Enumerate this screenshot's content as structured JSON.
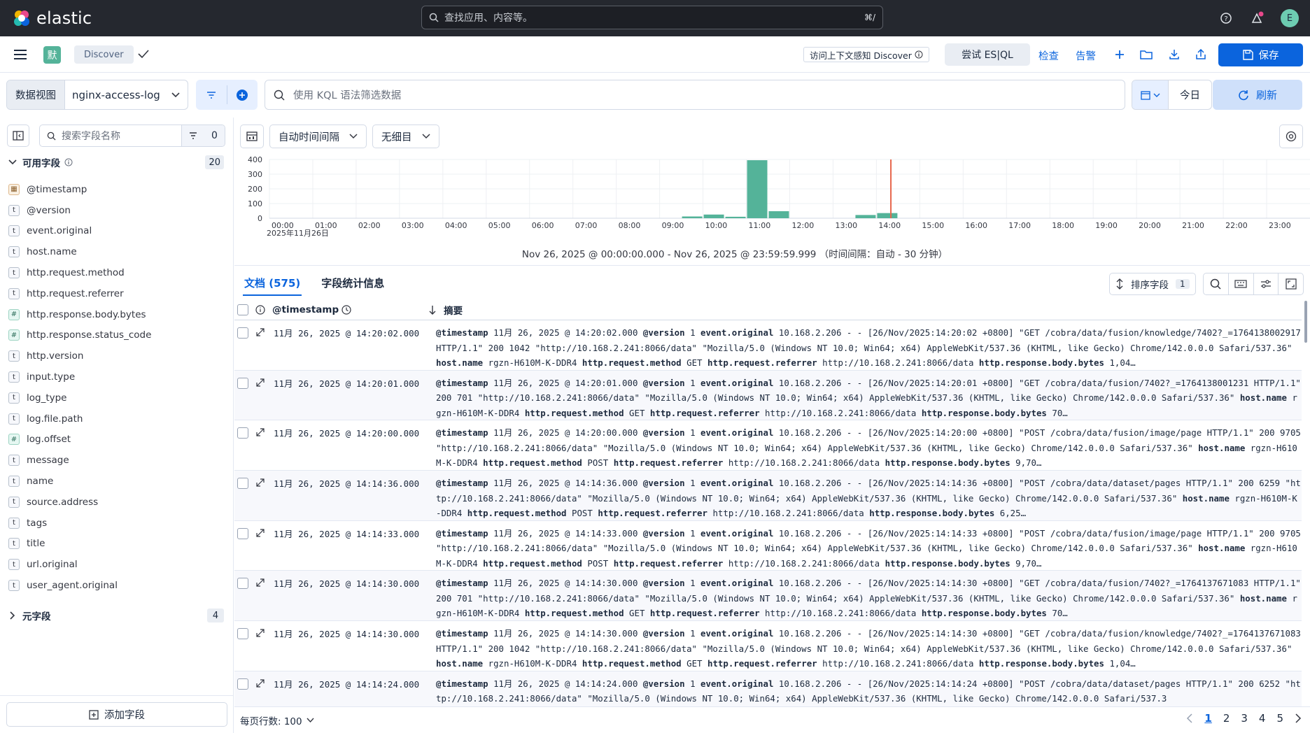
{
  "header": {
    "brand": "elastic",
    "search_placeholder": "查找应用、内容等。",
    "search_shortcut": "⌘/",
    "avatar_initial": "E",
    "colors": {
      "header_bg": "#25282f",
      "accent": "#0b64dd",
      "brand_green": "#54b399"
    }
  },
  "appbar": {
    "space_initial": "默",
    "breadcrumb": "Discover",
    "context_button": "访问上下文感知 Discover",
    "esql_button": "尝试 ES|QL",
    "inspect": "检查",
    "alerts": "告警",
    "save": "保存"
  },
  "querybar": {
    "dataview_label": "数据视图",
    "dataview_value": "nginx-access-log",
    "kql_placeholder": "使用 KQL 语法筛选数据",
    "date_text": "今日",
    "refresh": "刷新"
  },
  "sidebar": {
    "search_placeholder": "搜索字段名称",
    "filter_count": "0",
    "available_title": "可用字段",
    "available_count": "20",
    "meta_title": "元字段",
    "meta_count": "4",
    "add_field": "添加字段",
    "fields": [
      {
        "name": "@timestamp",
        "type": "date",
        "glyph": "▦"
      },
      {
        "name": "@version",
        "type": "text",
        "glyph": "t"
      },
      {
        "name": "event.original",
        "type": "text",
        "glyph": "t"
      },
      {
        "name": "host.name",
        "type": "text",
        "glyph": "t"
      },
      {
        "name": "http.request.method",
        "type": "text",
        "glyph": "t"
      },
      {
        "name": "http.request.referrer",
        "type": "text",
        "glyph": "t"
      },
      {
        "name": "http.response.body.bytes",
        "type": "number",
        "glyph": "#"
      },
      {
        "name": "http.response.status_code",
        "type": "number",
        "glyph": "#"
      },
      {
        "name": "http.version",
        "type": "text",
        "glyph": "t"
      },
      {
        "name": "input.type",
        "type": "text",
        "glyph": "t"
      },
      {
        "name": "log_type",
        "type": "text",
        "glyph": "t"
      },
      {
        "name": "log.file.path",
        "type": "text",
        "glyph": "t"
      },
      {
        "name": "log.offset",
        "type": "number",
        "glyph": "#"
      },
      {
        "name": "message",
        "type": "text",
        "glyph": "t"
      },
      {
        "name": "name",
        "type": "text",
        "glyph": "t"
      },
      {
        "name": "source.address",
        "type": "text",
        "glyph": "t"
      },
      {
        "name": "tags",
        "type": "text",
        "glyph": "t"
      },
      {
        "name": "title",
        "type": "text",
        "glyph": "t"
      },
      {
        "name": "url.original",
        "type": "text",
        "glyph": "t"
      },
      {
        "name": "user_agent.original",
        "type": "text",
        "glyph": "t"
      }
    ]
  },
  "chart_tools": {
    "interval": "自动时间间隔",
    "breakdown": "无细目"
  },
  "chart_data": {
    "type": "bar",
    "categories": [
      "00:00",
      "00:30",
      "01:00",
      "01:30",
      "02:00",
      "02:30",
      "03:00",
      "03:30",
      "04:00",
      "04:30",
      "05:00",
      "05:30",
      "06:00",
      "06:30",
      "07:00",
      "07:30",
      "08:00",
      "08:30",
      "09:00",
      "09:30",
      "10:00",
      "10:30",
      "11:00",
      "11:30",
      "12:00",
      "12:30",
      "13:00",
      "13:30",
      "14:00",
      "14:30",
      "15:00",
      "15:30",
      "16:00",
      "16:30",
      "17:00",
      "17:30",
      "18:00",
      "18:30",
      "19:00",
      "19:30",
      "20:00",
      "20:30",
      "21:00",
      "21:30",
      "22:00",
      "22:30",
      "23:00",
      "23:30"
    ],
    "values": [
      0,
      0,
      0,
      0,
      0,
      0,
      0,
      0,
      0,
      0,
      0,
      0,
      0,
      0,
      0,
      0,
      0,
      0,
      0,
      12,
      25,
      10,
      395,
      48,
      0,
      0,
      0,
      22,
      35,
      0,
      0,
      0,
      0,
      0,
      0,
      0,
      0,
      0,
      0,
      0,
      0,
      0,
      0,
      0,
      0,
      0,
      0,
      0
    ],
    "x_tick_labels": [
      "00:00",
      "01:00",
      "02:00",
      "03:00",
      "04:00",
      "05:00",
      "06:00",
      "07:00",
      "08:00",
      "09:00",
      "10:00",
      "11:00",
      "12:00",
      "13:00",
      "14:00",
      "15:00",
      "16:00",
      "17:00",
      "18:00",
      "19:00",
      "20:00",
      "21:00",
      "22:00",
      "23:00"
    ],
    "y_ticks": [
      0,
      100,
      200,
      300,
      400
    ],
    "ylim": [
      0,
      400
    ],
    "date_label": "2025年11月26日",
    "now_marker": "14:20",
    "bar_color": "#54b399",
    "marker_color": "#e7664c",
    "grid": true
  },
  "range_text": "Nov 26, 2025 @ 00:00:00.000 - Nov 26, 2025 @ 23:59:59.999  （时间间隔：自动 - 30 分钟）",
  "tabs": {
    "documents": "文档 (575)",
    "field_stats": "字段统计信息"
  },
  "grid": {
    "sort_label": "排序字段",
    "sort_count": "1",
    "col_timestamp": "@timestamp",
    "col_summary": "摘要",
    "rows": [
      {
        "ts": "11月 26, 2025 @ 14:20:02.000",
        "timestamp": "11月 26, 2025 @ 14:20:02.000",
        "version": "1",
        "event": "10.168.2.206 - - [26/Nov/2025:14:20:02 +0800] \"GET /cobra/data/fusion/knowledge/7402?_=1764138002917 HTTP/1.1\" 200 1042 \"http://10.168.2.241:8066/data\" \"Mozilla/5.0 (Windows NT 10.0; Win64; x64) AppleWebKit/537.36 (KHTML, like Gecko) Chrome/142.0.0.0 Safari/537.36\"",
        "host": "rgzn-H610M-K-DDR4",
        "method": "GET",
        "referrer": "http://10.168.2.241:8066/data",
        "bytes": "1,04…"
      },
      {
        "ts": "11月 26, 2025 @ 14:20:01.000",
        "timestamp": "11月 26, 2025 @ 14:20:01.000",
        "version": "1",
        "event": "10.168.2.206 - - [26/Nov/2025:14:20:01 +0800] \"GET /cobra/data/fusion/7402?_=1764138001231 HTTP/1.1\" 200 701 \"http://10.168.2.241:8066/data\" \"Mozilla/5.0 (Windows NT 10.0; Win64; x64) AppleWebKit/537.36 (KHTML, like Gecko) Chrome/142.0.0.0 Safari/537.36\"",
        "host": "rgzn-H610M-K-DDR4",
        "method": "GET",
        "referrer": "http://10.168.2.241:8066/data",
        "bytes": "70…"
      },
      {
        "ts": "11月 26, 2025 @ 14:20:00.000",
        "timestamp": "11月 26, 2025 @ 14:20:00.000",
        "version": "1",
        "event": "10.168.2.206 - - [26/Nov/2025:14:20:00 +0800] \"POST /cobra/data/fusion/image/page HTTP/1.1\" 200 9705 \"http://10.168.2.241:8066/data\" \"Mozilla/5.0 (Windows NT 10.0; Win64; x64) AppleWebKit/537.36 (KHTML, like Gecko) Chrome/142.0.0.0 Safari/537.36\"",
        "host": "rgzn-H610M-K-DDR4",
        "method": "POST",
        "referrer": "http://10.168.2.241:8066/data",
        "bytes": "9,70…"
      },
      {
        "ts": "11月 26, 2025 @ 14:14:36.000",
        "timestamp": "11月 26, 2025 @ 14:14:36.000",
        "version": "1",
        "event": "10.168.2.206 - - [26/Nov/2025:14:14:36 +0800] \"POST /cobra/data/dataset/pages HTTP/1.1\" 200 6259 \"http://10.168.2.241:8066/data\" \"Mozilla/5.0 (Windows NT 10.0; Win64; x64) AppleWebKit/537.36 (KHTML, like Gecko) Chrome/142.0.0.0 Safari/537.36\"",
        "host": "rgzn-H610M-K-DDR4",
        "method": "POST",
        "referrer": "http://10.168.2.241:8066/data",
        "bytes": "6,25…"
      },
      {
        "ts": "11月 26, 2025 @ 14:14:33.000",
        "timestamp": "11月 26, 2025 @ 14:14:33.000",
        "version": "1",
        "event": "10.168.2.206 - - [26/Nov/2025:14:14:33 +0800] \"POST /cobra/data/fusion/image/page HTTP/1.1\" 200 9705 \"http://10.168.2.241:8066/data\" \"Mozilla/5.0 (Windows NT 10.0; Win64; x64) AppleWebKit/537.36 (KHTML, like Gecko) Chrome/142.0.0.0 Safari/537.36\"",
        "host": "rgzn-H610M-K-DDR4",
        "method": "POST",
        "referrer": "http://10.168.2.241:8066/data",
        "bytes": "9,70…"
      },
      {
        "ts": "11月 26, 2025 @ 14:14:30.000",
        "timestamp": "11月 26, 2025 @ 14:14:30.000",
        "version": "1",
        "event": "10.168.2.206 - - [26/Nov/2025:14:14:30 +0800] \"GET /cobra/data/fusion/7402?_=1764137671083 HTTP/1.1\" 200 701 \"http://10.168.2.241:8066/data\" \"Mozilla/5.0 (Windows NT 10.0; Win64; x64) AppleWebKit/537.36 (KHTML, like Gecko) Chrome/142.0.0.0 Safari/537.36\"",
        "host": "rgzn-H610M-K-DDR4",
        "method": "GET",
        "referrer": "http://10.168.2.241:8066/data",
        "bytes": "70…"
      },
      {
        "ts": "11月 26, 2025 @ 14:14:30.000",
        "timestamp": "11月 26, 2025 @ 14:14:30.000",
        "version": "1",
        "event": "10.168.2.206 - - [26/Nov/2025:14:14:30 +0800] \"GET /cobra/data/fusion/knowledge/7402?_=1764137671083 HTTP/1.1\" 200 1042 \"http://10.168.2.241:8066/data\" \"Mozilla/5.0 (Windows NT 10.0; Win64; x64) AppleWebKit/537.36 (KHTML, like Gecko) Chrome/142.0.0.0 Safari/537.36\"",
        "host": "rgzn-H610M-K-DDR4",
        "method": "GET",
        "referrer": "http://10.168.2.241:8066/data",
        "bytes": "1,04…"
      },
      {
        "ts": "11月 26, 2025 @ 14:14:24.000",
        "timestamp": "11月 26, 2025 @ 14:14:24.000",
        "version": "1",
        "event": "10.168.2.206 - - [26/Nov/2025:14:14:24 +0800] \"POST /cobra/data/dataset/pages HTTP/1.1\" 200 6252 \"http://10.168.2.241:8066/data\" \"Mozilla/5.0 (Windows NT 10.0; Win64; x64) AppleWebKit/537.36 (KHTML, like Gecko) Chrome/142.0.0.0 Safari/537.3",
        "host": "",
        "method": "",
        "referrer": "",
        "bytes": ""
      }
    ],
    "summary_labels": {
      "timestamp": "@timestamp",
      "version": "@version",
      "event": "event.original",
      "host": "host.name",
      "method": "http.request.method",
      "referrer": "http.request.referrer",
      "bytes": "http.response.body.bytes"
    }
  },
  "footer": {
    "rows_per_page": "每页行数: 100",
    "pages": [
      "1",
      "2",
      "3",
      "4",
      "5"
    ],
    "current_page": "1"
  }
}
